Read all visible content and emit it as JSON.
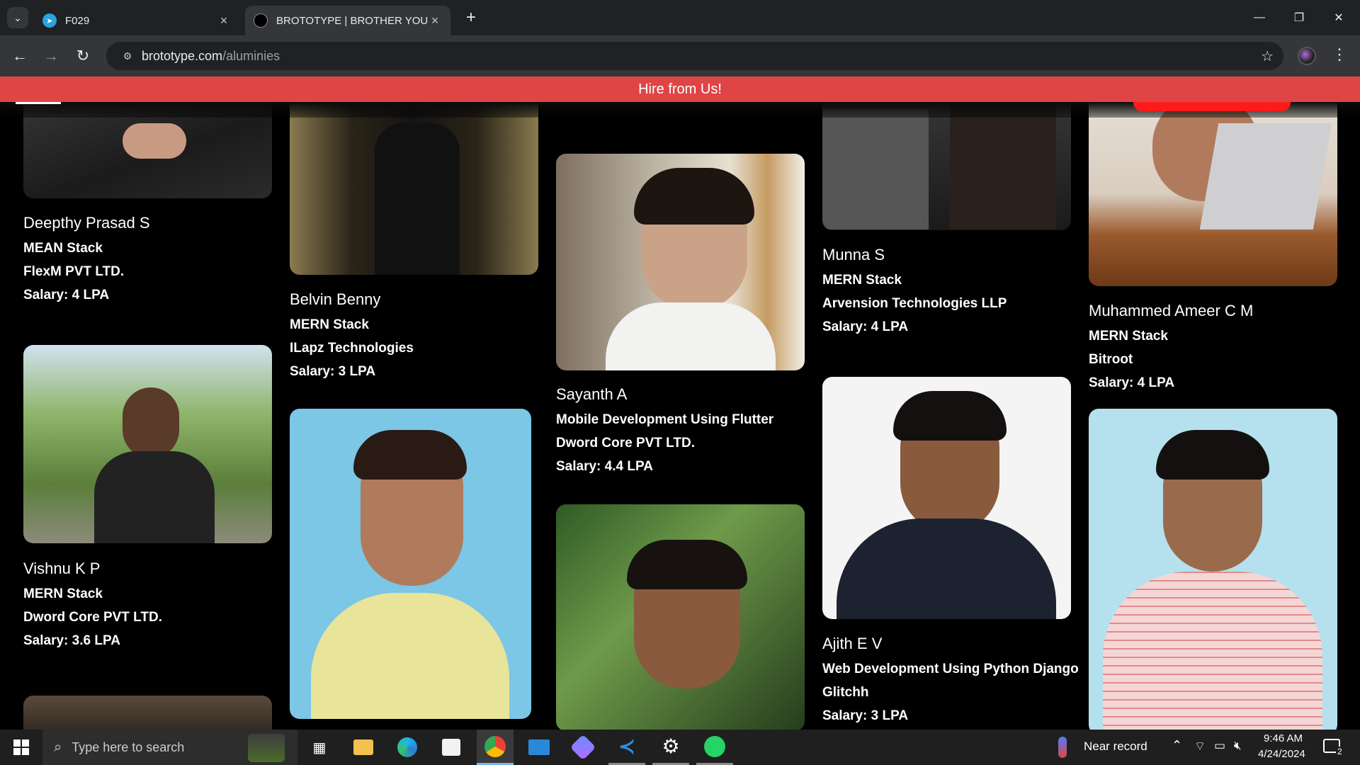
{
  "browser": {
    "tabs": [
      {
        "title": "F029"
      },
      {
        "title": "BROTOTYPE | BROTHER YOU NEVER HAD"
      }
    ],
    "url_domain": "brototype.com",
    "url_path": "/aluminies"
  },
  "banner": {
    "text": "Hire from Us!"
  },
  "alumni": [
    {
      "name": "Deepthy Prasad S",
      "course": "MEAN Stack",
      "company": "FlexM PVT LTD.",
      "salary": "Salary: 4 LPA"
    },
    {
      "name": "Vishnu K P",
      "course": "MERN Stack",
      "company": "Dword Core PVT LTD.",
      "salary": "Salary: 3.6 LPA"
    },
    {
      "name": "Belvin Benny",
      "course": "MERN Stack",
      "company": "ILapz Technologies",
      "salary": "Salary: 3 LPA"
    },
    {
      "name": "Sayanth A",
      "course": "Mobile Development Using Flutter",
      "company": "Dword Core PVT LTD.",
      "salary": "Salary: 4.4 LPA"
    },
    {
      "name": "Munna S",
      "course": "MERN Stack",
      "company": "Arvension Technologies LLP",
      "salary": "Salary: 4 LPA"
    },
    {
      "name": "Ajith E V",
      "course": "Web Development Using Python Django",
      "company": "Glitchh",
      "salary": "Salary: 3 LPA"
    },
    {
      "name": "Muhammed Ameer C M",
      "course": "MERN Stack",
      "company": "Bitroot",
      "salary": "Salary: 4 LPA"
    }
  ],
  "taskbar": {
    "search_placeholder": "Type here to search",
    "weather": "Near record",
    "time": "9:46 AM",
    "date": "4/24/2024",
    "notifications": "2"
  }
}
